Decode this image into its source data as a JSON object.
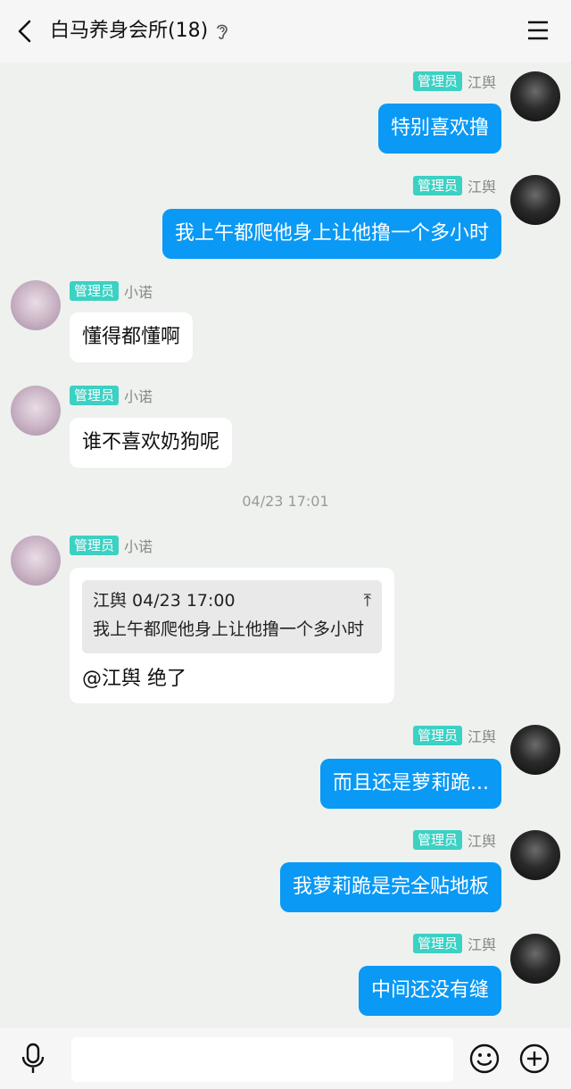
{
  "header": {
    "title": "白马养身会所(18)"
  },
  "badge_label": "管理员",
  "messages": [
    {
      "sender": "江舆",
      "text": "特别喜欢撸"
    },
    {
      "sender": "江舆",
      "text": "我上午都爬他身上让他撸一个多小时"
    },
    {
      "sender": "小诺",
      "text": "懂得都懂啊"
    },
    {
      "sender": "小诺",
      "text": "谁不喜欢奶狗呢"
    },
    {
      "sender": "小诺",
      "quote_head": "江舆 04/23 17:00",
      "quote_icon": "⤒",
      "quote_body": "我上午都爬他身上让他撸一个多小时",
      "text": "@江舆 绝了"
    },
    {
      "sender": "江舆",
      "text": "而且还是萝莉跪..."
    },
    {
      "sender": "江舆",
      "text": "我萝莉跪是完全贴地板"
    },
    {
      "sender": "江舆",
      "text": "中间还没有缝"
    }
  ],
  "time_divider": "04/23 17:01",
  "input": {
    "placeholder": ""
  },
  "colors": {
    "out_bubble": "#0a99f5",
    "in_bubble": "#ffffff",
    "badge": "#3bd1c3",
    "background": "#eef1ee"
  }
}
